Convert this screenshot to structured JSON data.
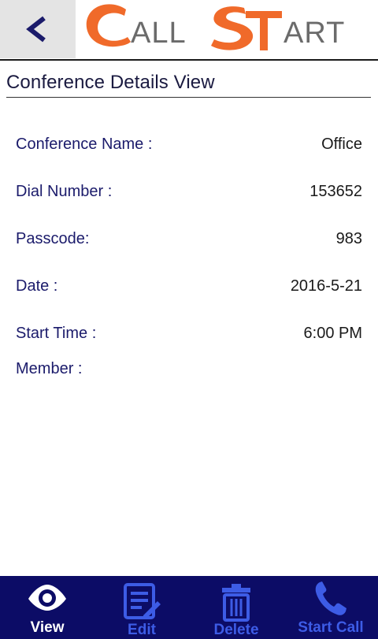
{
  "app": {
    "logo_text": "CALLSTART"
  },
  "page": {
    "title": "Conference Details View"
  },
  "details": [
    {
      "label": "Conference Name :",
      "value": "Office"
    },
    {
      "label": "Dial Number :",
      "value": "153652"
    },
    {
      "label": "Passcode:",
      "value": "983"
    },
    {
      "label": "Date :",
      "value": "2016-5-21"
    },
    {
      "label": "Start Time :",
      "value": "6:00 PM"
    },
    {
      "label": "Member :",
      "value": ""
    }
  ],
  "nav": [
    {
      "label": "View",
      "icon": "eye-icon",
      "active": true
    },
    {
      "label": "Edit",
      "icon": "edit-note-icon",
      "active": false
    },
    {
      "label": "Delete",
      "icon": "trash-icon",
      "active": false
    },
    {
      "label": "Start Call",
      "icon": "phone-icon",
      "active": false
    }
  ],
  "colors": {
    "nav_background": "#0c0c66",
    "nav_active": "#ffffff",
    "nav_inactive": "#3d5ce6",
    "logo_orange": "#f06a2a",
    "logo_gray": "#6b6b6b",
    "label_text": "#1b1b6b"
  }
}
